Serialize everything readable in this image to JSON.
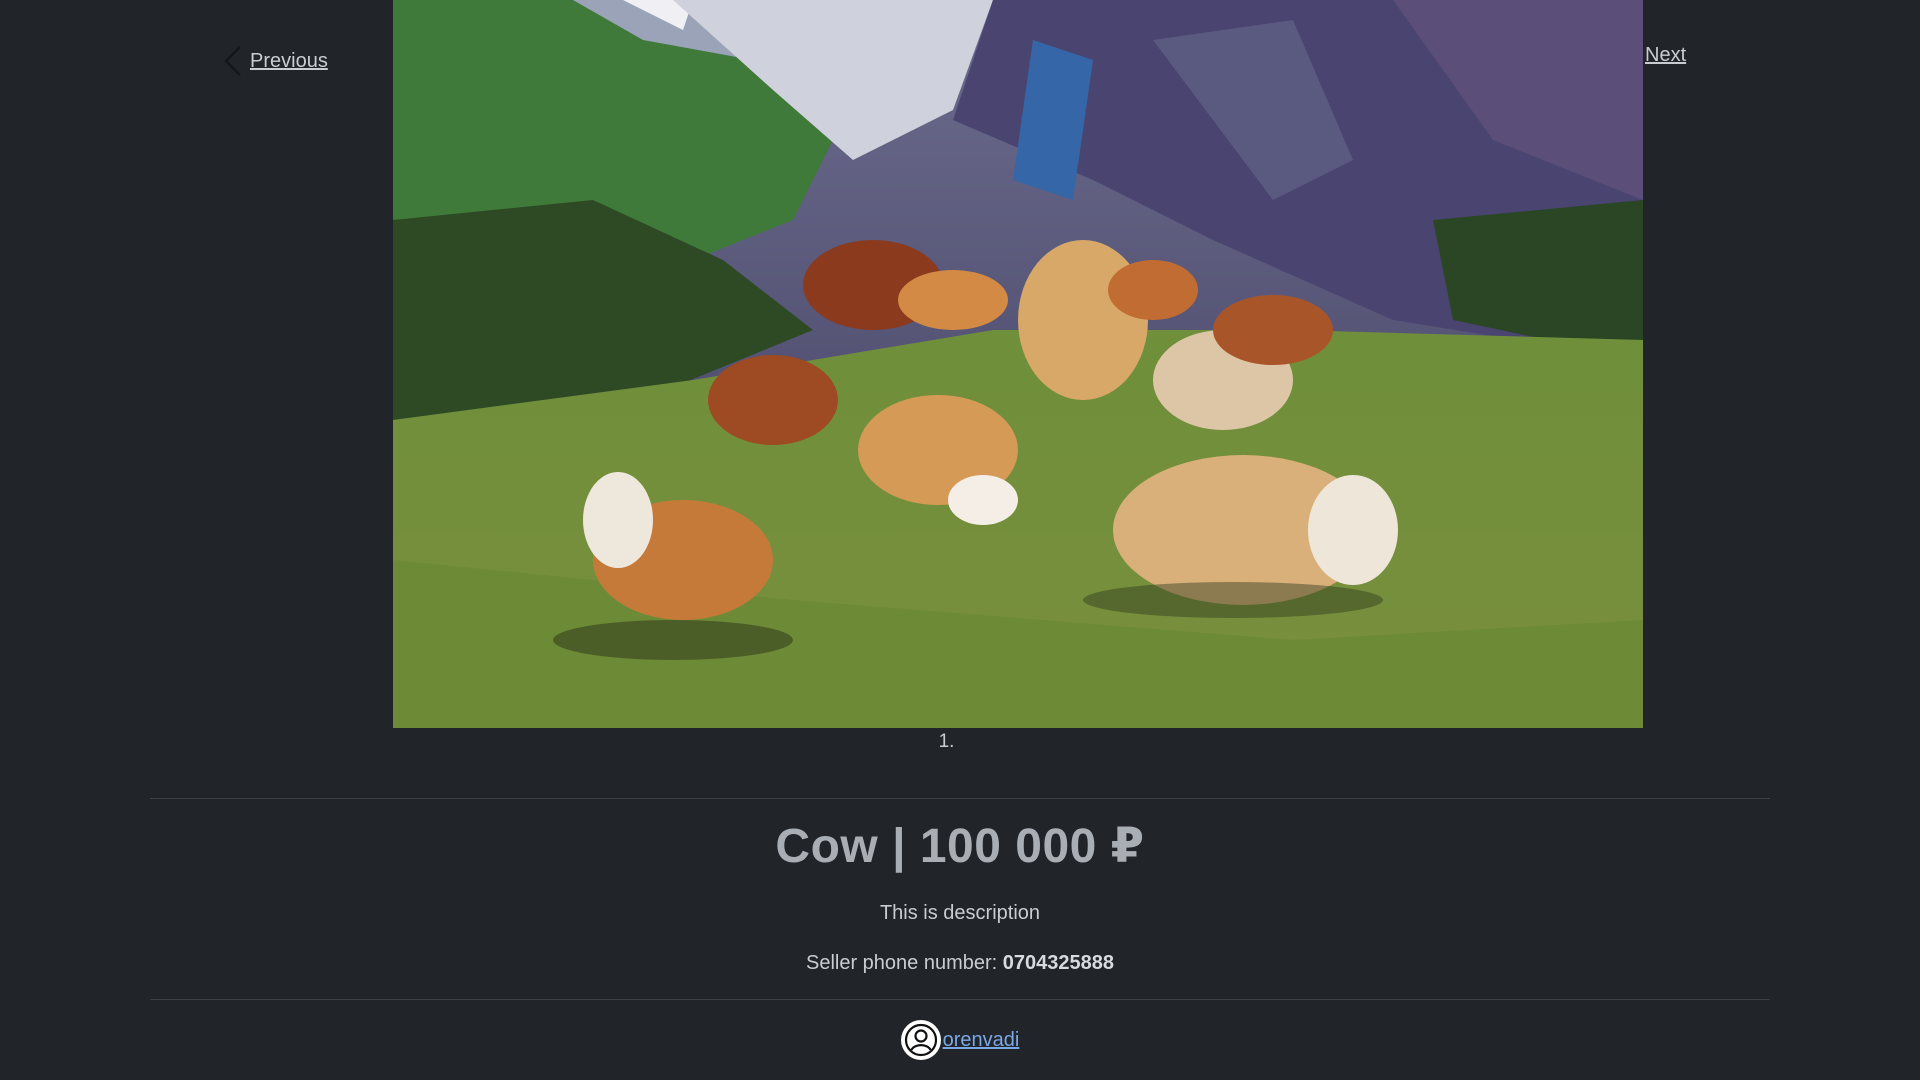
{
  "carousel": {
    "prev_label": "Previous",
    "next_label": "Next",
    "caption": "1."
  },
  "listing": {
    "title": "Cow | 100 000 ₽",
    "description": "This is description",
    "phone_label": "Seller phone number:",
    "phone_number": "0704325888"
  },
  "seller": {
    "username": "orenvadi",
    "avatar_icon": "user-circle-icon"
  },
  "colors": {
    "background": "#212429",
    "link": "#7aa7e6",
    "title": "#a9aeb5"
  }
}
